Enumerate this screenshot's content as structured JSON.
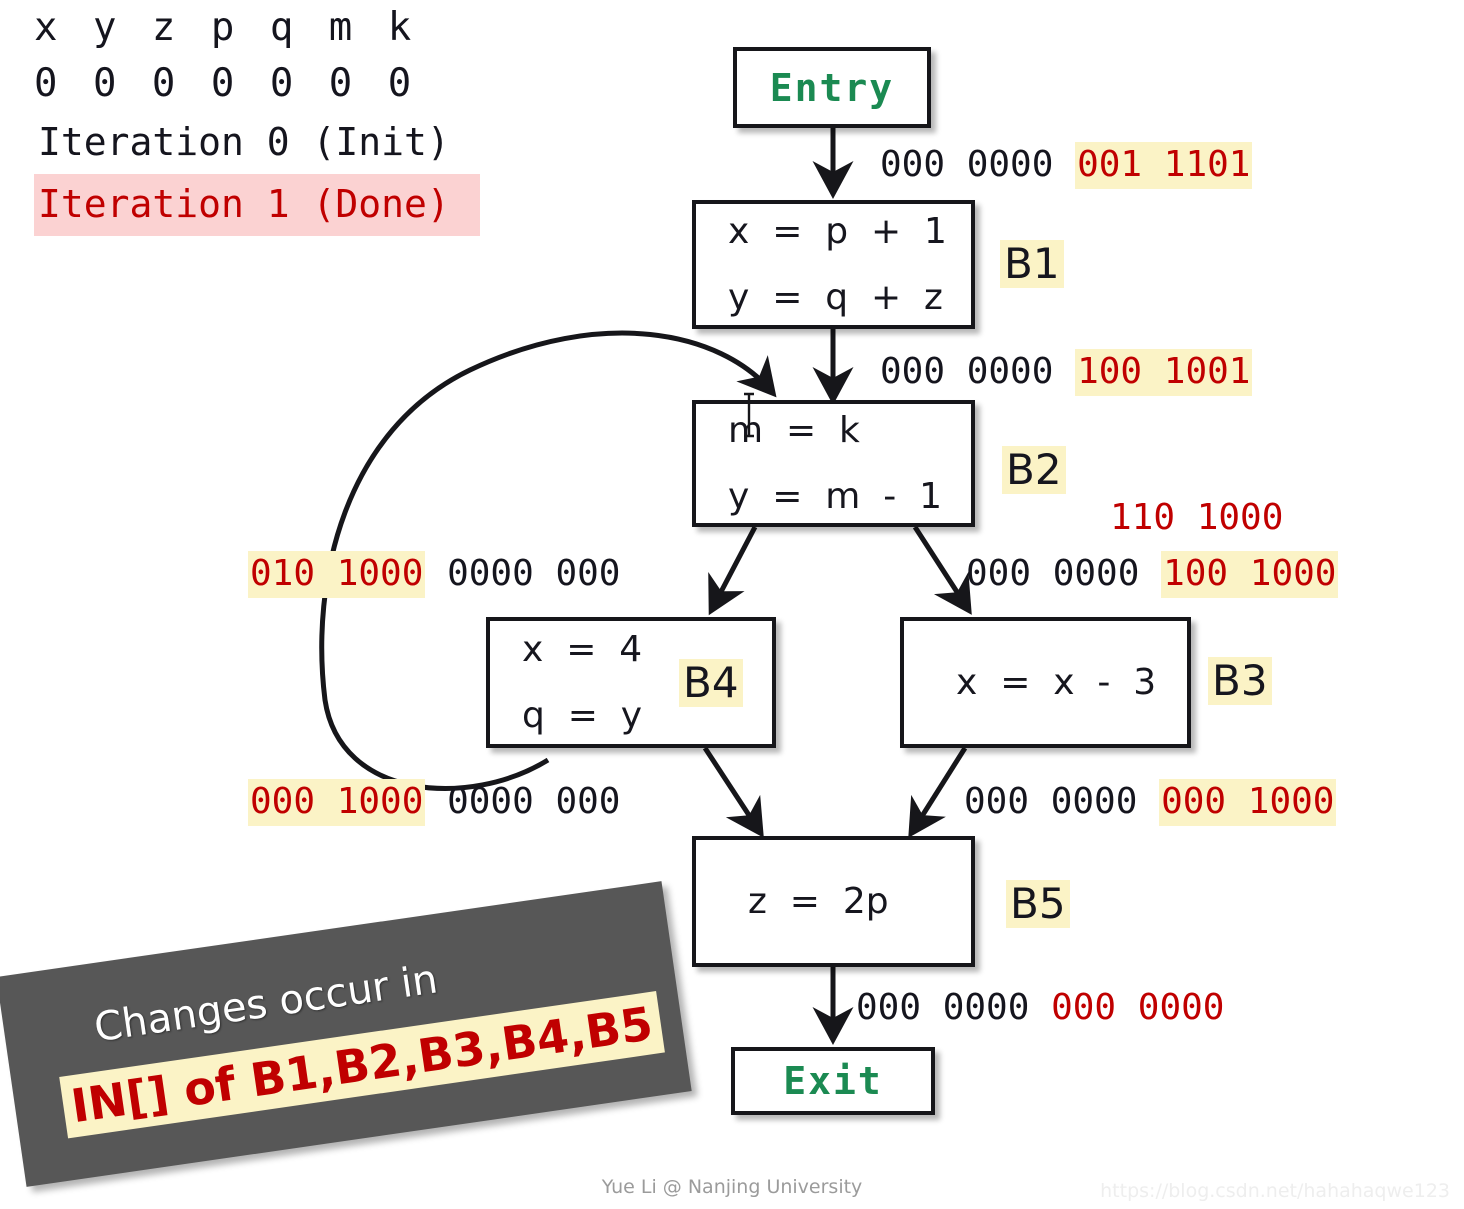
{
  "legend": {
    "variables": "x y z p q m k",
    "bits": "0 0 0 0 0 0 0",
    "iteration_init": "Iteration 0 (Init)",
    "iteration_done": "Iteration 1 (Done)"
  },
  "colors": {
    "entry_exit_text": "#1b8a52",
    "red": "#c00000",
    "highlight": "#fbf3c6",
    "pink_highlight": "#fbd2d2",
    "banner_bg": "#575757",
    "node_border": "#16161a"
  },
  "nodes": {
    "entry": {
      "label": "Entry",
      "tag": ""
    },
    "b1": {
      "tag": "B1",
      "statements": [
        "x  =  p  +  1",
        "y  =  q  +  z"
      ]
    },
    "b2": {
      "tag": "B2",
      "statements": [
        "m  =  k",
        "y  =  m  -  1"
      ]
    },
    "b4": {
      "tag": "B4",
      "statements": [
        "x  =  4",
        "q  =  y"
      ]
    },
    "b3": {
      "tag": "B3",
      "statements": [
        "x  =  x  -  3"
      ]
    },
    "b5": {
      "tag": "B5",
      "statements": [
        "z  =  2p"
      ]
    },
    "exit": {
      "label": "Exit",
      "tag": ""
    }
  },
  "annotations": {
    "entry_to_b1": {
      "black": "000 0000",
      "red": "001 1101",
      "highlighted": true
    },
    "b1_to_b2": {
      "black": "000 0000",
      "red": "100 1001",
      "highlighted": true
    },
    "b2_extra_red": {
      "red": "110 1000",
      "highlighted": false
    },
    "b2_to_b3": {
      "black": "000 0000",
      "red": "100 1000",
      "highlighted": true
    },
    "b2_to_b4": {
      "red": "010 1000",
      "black": "0000 000",
      "highlighted": true
    },
    "b4_to_b5": {
      "red": "000 1000",
      "black": "0000 000",
      "highlighted": true
    },
    "b3_to_b5": {
      "black": "000 0000",
      "red": "000 1000",
      "highlighted": true
    },
    "b5_to_exit": {
      "black": "000 0000",
      "red": "000 0000",
      "highlighted": false
    }
  },
  "callout": {
    "line1": "Changes occur in",
    "line2": "IN[] of B1,B2,B3,B4,B5"
  },
  "footer": {
    "attribution": "Yue Li @ Nanjing University",
    "watermark": "https://blog.csdn.net/hahahaqwe123"
  }
}
